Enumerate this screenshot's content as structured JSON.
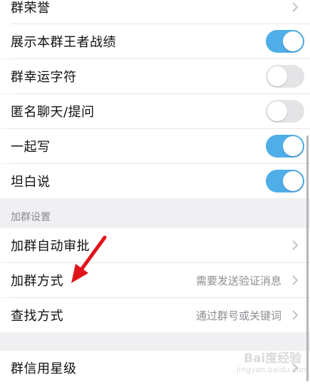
{
  "settings": {
    "group_honor": {
      "label": "群荣誉"
    },
    "show_king_record": {
      "label": "展示本群王者战绩",
      "enabled": true
    },
    "lucky_char": {
      "label": "群幸运字符",
      "enabled": false
    },
    "anonymous_chat": {
      "label": "匿名聊天/提问",
      "enabled": false
    },
    "write_together": {
      "label": "一起写",
      "enabled": true
    },
    "be_honest": {
      "label": "坦白说",
      "enabled": true
    }
  },
  "join_section": {
    "header": "加群设置",
    "auto_approve": {
      "label": "加群自动审批"
    },
    "join_method": {
      "label": "加群方式",
      "value": "需要发送验证消息"
    },
    "find_method": {
      "label": "查找方式",
      "value": "通过群号或关键词"
    }
  },
  "credit": {
    "label": "群信用星级"
  },
  "watermark": {
    "main": "Bai度经验",
    "sub": "jingyan.baidu.com"
  },
  "colors": {
    "toggle_on": "#4faee8",
    "toggle_off": "#e4e4e6",
    "arrow": "#e0141c"
  }
}
